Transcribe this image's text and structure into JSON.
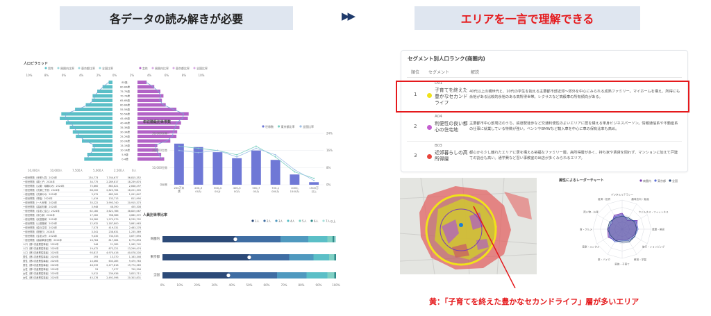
{
  "banners": {
    "left": "各データの読み解きが必要",
    "right": "エリアを一言で理解できる",
    "arrow": "▶▶"
  },
  "pyramid": {
    "title": "人口ピラミッド",
    "legend_left": [
      "男性",
      "周囲内比率",
      "東京都比率",
      "全国比率"
    ],
    "legend_right": [
      "女性",
      "周囲内比率",
      "東京都比率",
      "全国比率"
    ],
    "top_ticks": [
      "10%",
      "8%",
      "6%",
      "4%",
      "2%",
      "0%",
      "2%",
      "4%",
      "6%",
      "8%",
      "10%"
    ],
    "age_labels": [
      "85歳-",
      "80-84歳",
      "75-79歳",
      "70-74歳",
      "65-69歳",
      "60-64歳",
      "55-59歳",
      "50-54歳",
      "45-49歳",
      "40-44歳",
      "35-39歳",
      "30-34歳",
      "25-29歳",
      "20-24歳",
      "15-19歳",
      "10-14歳",
      "5-9歳",
      "0-4歳"
    ],
    "male_values": [
      0.5,
      1.3,
      2.0,
      2.6,
      2.7,
      3.5,
      4.9,
      6.7,
      6.9,
      6.1,
      5.6,
      5.2,
      4.8,
      4.0,
      2.6,
      2.7,
      3.3,
      3.7
    ],
    "female_values": [
      1.2,
      2.2,
      3.0,
      3.4,
      3.2,
      3.7,
      5.1,
      6.7,
      6.6,
      5.7,
      5.5,
      5.2,
      5.1,
      4.3,
      2.6,
      2.7,
      3.1,
      3.5
    ],
    "bottom_ticks": [
      "10,000人",
      "10,000人",
      "7,500人",
      "5,000人",
      "2,500人",
      "0人"
    ]
  },
  "income_chart": {
    "title": "年収階級別世帯数",
    "legend": [
      "世帯数",
      "東京都比率",
      "全国比率"
    ],
    "y_left_ticks": [
      "30,000世帯",
      "20,000世帯",
      "10,000世帯",
      "0世帯"
    ],
    "y_right_ticks": [
      "24%",
      "16%",
      "8%",
      "0%"
    ],
    "categories": [
      "200万未満",
      "200-300万",
      "300-400万",
      "400-500万",
      "500-700万",
      "700-1000万",
      "1000-1500万",
      "1500万以上"
    ],
    "values": [
      24000,
      22000,
      19000,
      15500,
      20000,
      14500,
      6000,
      1500
    ],
    "ratio_a": [
      18,
      17,
      16,
      14,
      18,
      13,
      6,
      3
    ],
    "ratio_b": [
      16,
      15,
      16,
      13,
      17,
      14,
      7,
      2
    ],
    "ylim": [
      0,
      30000
    ]
  },
  "household_chart": {
    "title": "人員別世帯比率",
    "legend": [
      "1人",
      "2人",
      "3人",
      "4人",
      "5人",
      "6人",
      "7人以上"
    ],
    "rows": [
      {
        "label": "商圏内",
        "values": [
          42,
          26,
          16,
          11,
          3,
          1,
          1
        ]
      },
      {
        "label": "東京都",
        "values": [
          50,
          23,
          14,
          9,
          3,
          1,
          0
        ]
      },
      {
        "label": "全国",
        "values": [
          38,
          28,
          17,
          12,
          4,
          1,
          0
        ]
      }
    ],
    "x_ticks": [
      "0%",
      "10%",
      "20%",
      "30%",
      "40%",
      "50%",
      "60%",
      "70%",
      "80%",
      "90%",
      "100%"
    ]
  },
  "data_table": {
    "rows": [
      [
        "一般世帯数（世帯人員）2024年",
        "134,773",
        "7,744,677",
        "56,815,352"
      ],
      [
        "一般世帯数（親と子）2024年",
        "34,775",
        "2,289,817",
        "18,239,874"
      ],
      [
        "一般世帯数（父親・母親のみ）2024年",
        "75,860",
        "863,821",
        "2,848,297"
      ],
      [
        "一般世帯数（夫婦と子供）2024年",
        "68,200",
        "2,823,764",
        "16,221,305"
      ],
      [
        "一般世帯数（夫婦のみ）2024年",
        "3,979",
        "683,261",
        "1,091,847"
      ],
      [
        "一般世帯数（単独）2024年",
        "1,419",
        "133,713",
        "811,990"
      ],
      [
        "一般世帯数（一人世帯）2024年",
        "35,222",
        "3,993,740",
        "20,915,373"
      ],
      [
        "一般世帯数（高齢夫婦）2024年",
        "3,948",
        "48,390",
        "455,308"
      ],
      [
        "一般世帯数（住宅に住む）2024年",
        "62,180",
        "3,622,786",
        "38,825,067"
      ],
      [
        "一般世帯数（持ち家）2024年",
        "17,262",
        "768,586",
        "4,682,372"
      ],
      [
        "一般世帯数（民営借家）2024年",
        "28,380",
        "1,970,979",
        "8,239,702"
      ],
      [
        "一般世帯数（公営借家）2024年",
        "12,932",
        "1,187,800",
        "3,861,963"
      ],
      [
        "一般世帯数（給与住宅）2024年",
        "7,573",
        "419,331",
        "2,463,278"
      ],
      [
        "一般世帯数（間借り）2024年",
        "3,341",
        "238,631",
        "1,235,369"
      ],
      [
        "一般世帯数（住宅以外）2024年",
        "9,430",
        "734,533",
        "3,877,694"
      ],
      [
        "一般世帯数（高齢単身世帯）2024年",
        "16,784",
        "817,084",
        "6,774,894"
      ],
      [
        "人口（第1次産業従事者）2024年",
        "346",
        "21,285",
        "1,962,742"
      ],
      [
        "人口（第2次産業従事者）2024年",
        "19,472",
        "873,221",
        "13,299,474"
      ],
      [
        "人口（第3次産業従事者）2024年",
        "93,817",
        "4,970,416",
        "40,078,200"
      ],
      [
        "男性（第1次産業従事者）2024年",
        "293",
        "13,370",
        "1,163,346"
      ],
      [
        "男性（第2次産業従事者）2024年",
        "14,460",
        "633,285",
        "9,475,763"
      ],
      [
        "男性（第3次産業従事者）2024年",
        "48,539",
        "2,477,818",
        "19,774,369"
      ],
      [
        "女性（第1次産業従事者）2024年",
        "53",
        "7,977",
        "799,396"
      ],
      [
        "女性（第2次産業従事者）2024年",
        "5,012",
        "239,936",
        "3,823,711"
      ],
      [
        "女性（第3次産業従事者）2024年",
        "45,278",
        "2,492,598",
        "20,303,831"
      ]
    ]
  },
  "segment_ranking": {
    "title": "セグメント別人口ランク(商圏内)",
    "headers": [
      "順位",
      "セグメント",
      "解説"
    ],
    "items": [
      {
        "rank": "1",
        "code": "D01",
        "name": "子育てを終えた豊かなセカンドライフ",
        "desc": "40代以上の親世代と、10代の学生を抱える主要都市部近郊〜郊外を中心にみられる成熟ファミリー。マイホームを構え、所得にも余裕がある比較的余裕のある高所得世帯。レクサスなど高級車の所有傾向がある。",
        "color": "#f0e21a"
      },
      {
        "rank": "2",
        "code": "A04",
        "name": "利便性の良い都心の住宅地",
        "desc": "主要都市中心部周辺のうち、鉄道駅徒歩など交通利便性のよいエリアに居を構える単身ビジネスパーソン。情報通信系や不動産系の仕事に就業している特徴が強い。ベンツやBMWなど輸入車を中心に車の保有比率も高め。",
        "color": "#c45fd0"
      },
      {
        "rank": "3",
        "code": "B03",
        "name": "近郊暮らしの高所得層",
        "desc": "都心から少し離れたエリアに居を構える裕福なファミリー層。高所得層が多く、持ち家や賃貸を問わず、マンションに加えて戸建ての割合も高い。通学費など習い事教室の出店が多くみられるエリア。",
        "color": "#e8453c"
      }
    ]
  },
  "radar": {
    "title": "属性によるレーダーチャート",
    "legend": [
      "商圏内",
      "東京都",
      "全国"
    ],
    "axes": [
      "デジタルリテラシー",
      "趣味志向・勉強",
      "ウェルネス・フィットネス",
      "健康・美容",
      "旅行・ショッピング",
      "教育・学習",
      "家族・子育て",
      "車・バイク",
      "音楽・エンタメ",
      "食・グルメ",
      "買い物・お得",
      "経済・投資"
    ],
    "series": [
      {
        "name": "商圏内",
        "values": [
          0.55,
          0.35,
          0.6,
          0.5,
          0.45,
          0.4,
          0.35,
          0.45,
          0.55,
          0.5,
          0.4,
          0.55
        ]
      },
      {
        "name": "東京都",
        "values": [
          0.5,
          0.4,
          0.55,
          0.55,
          0.5,
          0.45,
          0.4,
          0.5,
          0.5,
          0.45,
          0.45,
          0.5
        ]
      },
      {
        "name": "全国",
        "values": [
          0.45,
          0.45,
          0.5,
          0.5,
          0.5,
          0.5,
          0.45,
          0.45,
          0.45,
          0.5,
          0.5,
          0.45
        ]
      }
    ]
  },
  "annotation": "黄：「子育てを終えた豊かなセカンドライフ」層が多いエリア",
  "colors": {
    "teal": "#5bbfc7",
    "purple": "#b263c6",
    "bar_blue": "#6f78d6",
    "accent_red": "#e5191c",
    "banner_bg": "#dfe6f0"
  }
}
